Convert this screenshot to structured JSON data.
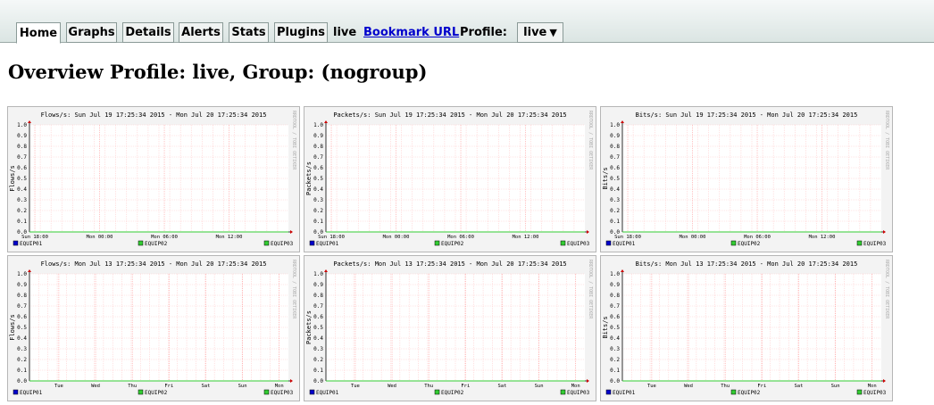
{
  "nav": {
    "tabs": [
      {
        "label": "Home",
        "active": true
      },
      {
        "label": "Graphs"
      },
      {
        "label": "Details"
      },
      {
        "label": "Alerts"
      },
      {
        "label": "Stats"
      },
      {
        "label": "Plugins"
      }
    ],
    "live_label": "live",
    "bookmark_label": "Bookmark URL",
    "profile_label": "Profile:",
    "profile_value": "live",
    "dropdown_glyph": "▼"
  },
  "page_title": "Overview Profile: live, Group: (nogroup)",
  "watermark": "RRDTOOL / TOBI OETIKER",
  "colors": {
    "EQUIP01": "#0000cc",
    "EQUIP02": "#33cc33",
    "EQUIP03": "#33cc33",
    "grid": "#ffcccc",
    "plot_bg": "#ffffff",
    "panel_bg": "#f3f3f3"
  },
  "chart_data": [
    {
      "type": "line",
      "title": "Flows/s: Sun Jul 19 17:25:34 2015 - Mon Jul 20 17:25:34 2015",
      "ylabel": "Flows/s",
      "ylim": [
        0,
        1
      ],
      "yticks": [
        "0.0",
        "0.1",
        "0.2",
        "0.3",
        "0.4",
        "0.5",
        "0.6",
        "0.7",
        "0.8",
        "0.9",
        "1.0"
      ],
      "xticks": [
        "Sun 18:00",
        "Mon 00:00",
        "Mon 06:00",
        "Mon 12:00"
      ],
      "series": [
        {
          "name": "EQUIP01",
          "values": [
            0,
            0
          ]
        },
        {
          "name": "EQUIP02",
          "values": [
            0,
            0
          ]
        },
        {
          "name": "EQUIP03",
          "values": [
            0,
            0
          ]
        }
      ],
      "legend": "bottom"
    },
    {
      "type": "line",
      "title": "Packets/s: Sun Jul 19 17:25:34 2015 - Mon Jul 20 17:25:34 2015",
      "ylabel": "Packets/s",
      "ylim": [
        0,
        1
      ],
      "yticks": [
        "0.0",
        "0.1",
        "0.2",
        "0.3",
        "0.4",
        "0.5",
        "0.6",
        "0.7",
        "0.8",
        "0.9",
        "1.0"
      ],
      "xticks": [
        "Sun 18:00",
        "Mon 00:00",
        "Mon 06:00",
        "Mon 12:00"
      ],
      "series": [
        {
          "name": "EQUIP01",
          "values": [
            0,
            0
          ]
        },
        {
          "name": "EQUIP02",
          "values": [
            0,
            0
          ]
        },
        {
          "name": "EQUIP03",
          "values": [
            0,
            0
          ]
        }
      ],
      "legend": "bottom"
    },
    {
      "type": "line",
      "title": "Bits/s: Sun Jul 19 17:25:34 2015 - Mon Jul 20 17:25:34 2015",
      "ylabel": "Bits/s",
      "ylim": [
        0,
        1
      ],
      "yticks": [
        "0.0",
        "0.1",
        "0.2",
        "0.3",
        "0.4",
        "0.5",
        "0.6",
        "0.7",
        "0.8",
        "0.9",
        "1.0"
      ],
      "xticks": [
        "Sun 18:00",
        "Mon 00:00",
        "Mon 06:00",
        "Mon 12:00"
      ],
      "series": [
        {
          "name": "EQUIP01",
          "values": [
            0,
            0
          ]
        },
        {
          "name": "EQUIP02",
          "values": [
            0,
            0
          ]
        },
        {
          "name": "EQUIP03",
          "values": [
            0,
            0
          ]
        }
      ],
      "legend": "bottom"
    },
    {
      "type": "line",
      "title": "Flows/s: Mon Jul 13 17:25:34 2015 - Mon Jul 20 17:25:34 2015",
      "ylabel": "Flows/s",
      "ylim": [
        0,
        1
      ],
      "yticks": [
        "0.0",
        "0.1",
        "0.2",
        "0.3",
        "0.4",
        "0.5",
        "0.6",
        "0.7",
        "0.8",
        "0.9",
        "1.0"
      ],
      "xticks": [
        "Tue",
        "Wed",
        "Thu",
        "Fri",
        "Sat",
        "Sun",
        "Mon"
      ],
      "series": [
        {
          "name": "EQUIP01",
          "values": [
            0,
            0
          ]
        },
        {
          "name": "EQUIP02",
          "values": [
            0,
            0
          ]
        },
        {
          "name": "EQUIP03",
          "values": [
            0,
            0
          ]
        }
      ],
      "legend": "bottom"
    },
    {
      "type": "line",
      "title": "Packets/s: Mon Jul 13 17:25:34 2015 - Mon Jul 20 17:25:34 2015",
      "ylabel": "Packets/s",
      "ylim": [
        0,
        1
      ],
      "yticks": [
        "0.0",
        "0.1",
        "0.2",
        "0.3",
        "0.4",
        "0.5",
        "0.6",
        "0.7",
        "0.8",
        "0.9",
        "1.0"
      ],
      "xticks": [
        "Tue",
        "Wed",
        "Thu",
        "Fri",
        "Sat",
        "Sun",
        "Mon"
      ],
      "series": [
        {
          "name": "EQUIP01",
          "values": [
            0,
            0
          ]
        },
        {
          "name": "EQUIP02",
          "values": [
            0,
            0
          ]
        },
        {
          "name": "EQUIP03",
          "values": [
            0,
            0
          ]
        }
      ],
      "legend": "bottom"
    },
    {
      "type": "line",
      "title": "Bits/s: Mon Jul 13 17:25:34 2015 - Mon Jul 20 17:25:34 2015",
      "ylabel": "Bits/s",
      "ylim": [
        0,
        1
      ],
      "yticks": [
        "0.0",
        "0.1",
        "0.2",
        "0.3",
        "0.4",
        "0.5",
        "0.6",
        "0.7",
        "0.8",
        "0.9",
        "1.0"
      ],
      "xticks": [
        "Tue",
        "Wed",
        "Thu",
        "Fri",
        "Sat",
        "Sun",
        "Mon"
      ],
      "series": [
        {
          "name": "EQUIP01",
          "values": [
            0,
            0
          ]
        },
        {
          "name": "EQUIP02",
          "values": [
            0,
            0
          ]
        },
        {
          "name": "EQUIP03",
          "values": [
            0,
            0
          ]
        }
      ],
      "legend": "bottom"
    }
  ]
}
